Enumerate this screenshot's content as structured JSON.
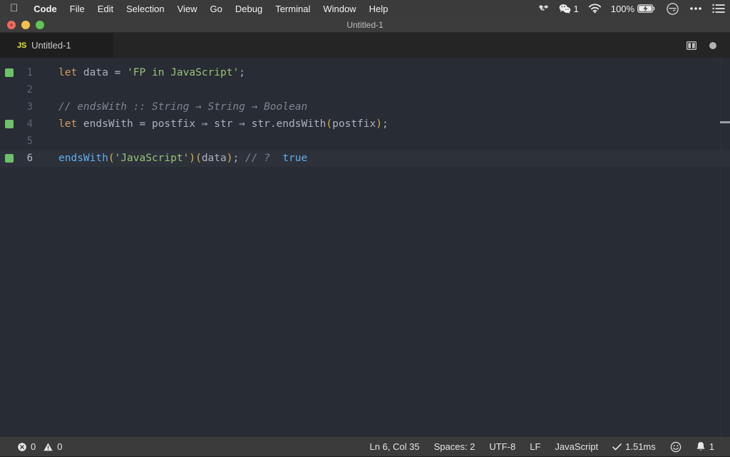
{
  "menubar": {
    "apple_icon": "apple-logo-icon",
    "items": [
      {
        "label": "Code",
        "bold": true
      },
      {
        "label": "File",
        "bold": false
      },
      {
        "label": "Edit",
        "bold": false
      },
      {
        "label": "Selection",
        "bold": false
      },
      {
        "label": "View",
        "bold": false
      },
      {
        "label": "Go",
        "bold": false
      },
      {
        "label": "Debug",
        "bold": false
      },
      {
        "label": "Terminal",
        "bold": false
      },
      {
        "label": "Window",
        "bold": false
      },
      {
        "label": "Help",
        "bold": false
      }
    ],
    "status_items": [
      {
        "icon": "dropbox-icon",
        "label": ""
      },
      {
        "icon": "wechat-icon",
        "label": "1"
      },
      {
        "icon": "wifi-icon",
        "label": ""
      },
      {
        "icon": "battery-charging-icon",
        "label": "100%"
      },
      {
        "icon": "do-not-disturb-icon",
        "label": ""
      },
      {
        "icon": "control-center-icon",
        "label": ""
      },
      {
        "icon": "notification-center-icon",
        "label": ""
      }
    ]
  },
  "window": {
    "title": "Untitled-1",
    "traffic_lights": [
      "close-button",
      "minimize-button",
      "maximize-button"
    ]
  },
  "tabs": [
    {
      "label": "Untitled-1",
      "file_type_badge": "JS",
      "dirty": true
    }
  ],
  "editor_actions": {
    "split_editor": "split-editor-icon",
    "unsaved_indicator": "unsaved-dot-icon"
  },
  "editor": {
    "language": "JavaScript",
    "lines": [
      {
        "number": "1",
        "marker": true,
        "active": false,
        "tokens": [
          {
            "t": "let",
            "c": "kw"
          },
          {
            "t": " data ",
            "c": "pl"
          },
          {
            "t": "= ",
            "c": "pl"
          },
          {
            "t": "'FP in JavaScript'",
            "c": "str"
          },
          {
            "t": ";",
            "c": "pl"
          }
        ]
      },
      {
        "number": "2",
        "marker": false,
        "active": false,
        "tokens": []
      },
      {
        "number": "3",
        "marker": false,
        "active": false,
        "tokens": [
          {
            "t": "// endsWith :: String → String → Boolean",
            "c": "cm"
          }
        ]
      },
      {
        "number": "4",
        "marker": true,
        "active": false,
        "tokens": [
          {
            "t": "let",
            "c": "kw"
          },
          {
            "t": " endsWith = postfix ⇒ str ⇒ str.endsWith",
            "c": "pl"
          },
          {
            "t": "(",
            "c": "paren"
          },
          {
            "t": "postfix",
            "c": "pl"
          },
          {
            "t": ")",
            "c": "paren"
          },
          {
            "t": ";",
            "c": "pl"
          }
        ]
      },
      {
        "number": "5",
        "marker": false,
        "active": false,
        "tokens": []
      },
      {
        "number": "6",
        "marker": true,
        "active": true,
        "tokens": [
          {
            "t": "endsWith",
            "c": "fn"
          },
          {
            "t": "(",
            "c": "paren"
          },
          {
            "t": "'JavaScript'",
            "c": "str"
          },
          {
            "t": ")",
            "c": "paren"
          },
          {
            "t": "(",
            "c": "paren"
          },
          {
            "t": "data",
            "c": "pl"
          },
          {
            "t": ")",
            "c": "paren"
          },
          {
            "t": ";",
            "c": "pl"
          },
          {
            "t": " // ?",
            "c": "cm"
          },
          {
            "t": "  true",
            "c": "lit"
          }
        ]
      }
    ]
  },
  "statusbar": {
    "errors": "0",
    "warnings": "0",
    "cursor_position": "Ln 6, Col 35",
    "indentation": "Spaces: 2",
    "encoding": "UTF-8",
    "eol": "LF",
    "language_mode": "JavaScript",
    "run_time": "1.51ms",
    "feedback_icon": "smiley-icon",
    "notifications_count": "1"
  },
  "colors": {
    "editor_bg": "#282c34",
    "keyword": "#d19a66",
    "string": "#98c379",
    "comment": "#7f848e",
    "function": "#61afef",
    "paren": "#d9b545",
    "marker_green": "#6ec06a",
    "statusbar_bg": "#3b3b3b"
  }
}
